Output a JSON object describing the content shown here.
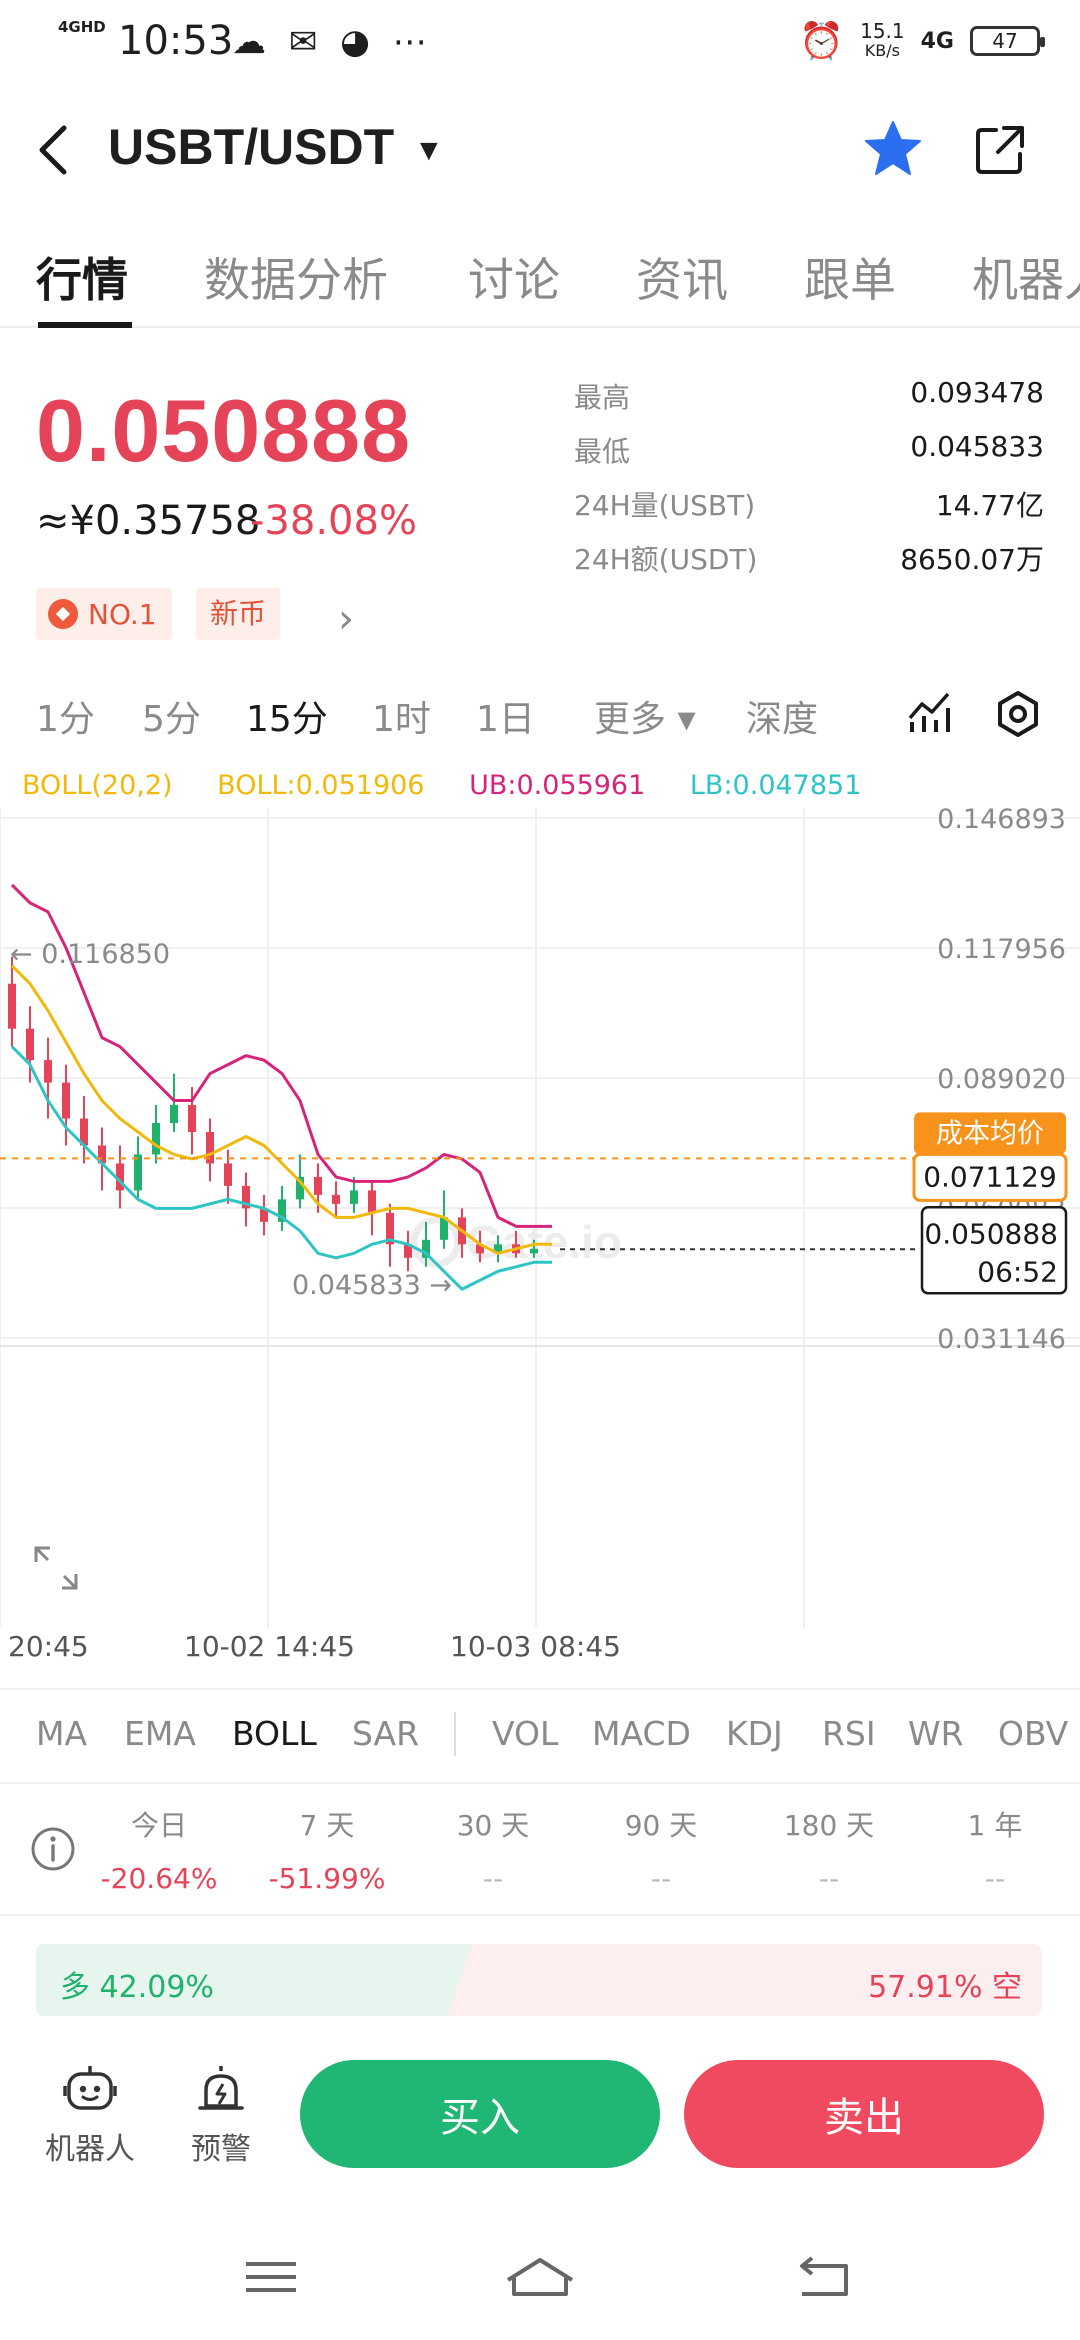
{
  "status_bar": {
    "network": "4GHD",
    "time": "10:53",
    "speed_value": "15.1",
    "speed_unit": "KB/s",
    "signal": "4G",
    "battery": "47"
  },
  "header": {
    "pair": "USBT/USDT"
  },
  "tabs": [
    "行情",
    "数据分析",
    "讨论",
    "资讯",
    "跟单",
    "机器人"
  ],
  "price": {
    "last": "0.050888",
    "cny": "≈¥0.35758",
    "change": "-38.08%",
    "badge_rank": "NO.1",
    "badge_new": "新币"
  },
  "stats": [
    {
      "label": "最高",
      "value": "0.093478"
    },
    {
      "label": "最低",
      "value": "0.045833"
    },
    {
      "label": "24H量(USBT)",
      "value": "14.77亿"
    },
    {
      "label": "24H额(USDT)",
      "value": "8650.07万"
    }
  ],
  "intervals": [
    "1分",
    "5分",
    "15分",
    "1时",
    "1日",
    "更多 ▾",
    "深度"
  ],
  "active_interval": "15分",
  "boll_legend": {
    "params": "BOLL(20,2)",
    "mid": "BOLL:0.051906",
    "ub": "UB:0.055961",
    "lb": "LB:0.047851"
  },
  "colors": {
    "up": "#20b26c",
    "down": "#e54458",
    "boll_mid": "#f0b90b",
    "boll_ub": "#d6247a",
    "boll_lb": "#2ec4c4",
    "cost_label": "#f7931a"
  },
  "chart_data": {
    "type": "candlestick",
    "price_axis_labels": [
      "0.146893",
      "0.117956",
      "0.089020",
      "0.060083",
      "0.031146"
    ],
    "ylim": [
      0.031146,
      0.146893
    ],
    "time_axis_labels": [
      "20:45",
      "10-02 14:45",
      "10-03 08:45"
    ],
    "high_marker": "0.116850",
    "low_marker": "0.045833",
    "cost_avg_label": "成本均价",
    "cost_avg_value": "0.071129",
    "last_price": "0.050888",
    "countdown": "06:52",
    "watermark": "Gate.io",
    "series": [
      {
        "name": "UB",
        "values": [
          0.132,
          0.128,
          0.126,
          0.118,
          0.108,
          0.098,
          0.096,
          0.092,
          0.088,
          0.084,
          0.084,
          0.09,
          0.092,
          0.094,
          0.093,
          0.09,
          0.084,
          0.072,
          0.067,
          0.066,
          0.066,
          0.066,
          0.067,
          0.069,
          0.072,
          0.071,
          0.068,
          0.058,
          0.056,
          0.056,
          0.056
        ]
      },
      {
        "name": "BOLL",
        "values": [
          0.114,
          0.11,
          0.104,
          0.097,
          0.09,
          0.084,
          0.08,
          0.077,
          0.074,
          0.072,
          0.071,
          0.072,
          0.074,
          0.076,
          0.074,
          0.07,
          0.066,
          0.061,
          0.058,
          0.058,
          0.059,
          0.06,
          0.06,
          0.059,
          0.058,
          0.055,
          0.052,
          0.05,
          0.051,
          0.052,
          0.052
        ]
      },
      {
        "name": "LB",
        "values": [
          0.096,
          0.092,
          0.084,
          0.078,
          0.074,
          0.07,
          0.066,
          0.062,
          0.06,
          0.06,
          0.06,
          0.061,
          0.062,
          0.061,
          0.06,
          0.058,
          0.055,
          0.05,
          0.049,
          0.05,
          0.052,
          0.053,
          0.052,
          0.05,
          0.046,
          0.042,
          0.044,
          0.046,
          0.047,
          0.048,
          0.048
        ]
      }
    ],
    "candles": [
      {
        "o": 0.11,
        "c": 0.1,
        "h": 0.116,
        "l": 0.096
      },
      {
        "o": 0.1,
        "c": 0.093,
        "h": 0.105,
        "l": 0.088
      },
      {
        "o": 0.093,
        "c": 0.088,
        "h": 0.098,
        "l": 0.08
      },
      {
        "o": 0.088,
        "c": 0.08,
        "h": 0.092,
        "l": 0.074
      },
      {
        "o": 0.08,
        "c": 0.074,
        "h": 0.085,
        "l": 0.07
      },
      {
        "o": 0.074,
        "c": 0.07,
        "h": 0.078,
        "l": 0.064
      },
      {
        "o": 0.07,
        "c": 0.064,
        "h": 0.074,
        "l": 0.06
      },
      {
        "o": 0.064,
        "c": 0.072,
        "h": 0.076,
        "l": 0.062
      },
      {
        "o": 0.072,
        "c": 0.079,
        "h": 0.083,
        "l": 0.07
      },
      {
        "o": 0.079,
        "c": 0.083,
        "h": 0.09,
        "l": 0.077
      },
      {
        "o": 0.083,
        "c": 0.077,
        "h": 0.087,
        "l": 0.072
      },
      {
        "o": 0.077,
        "c": 0.07,
        "h": 0.08,
        "l": 0.066
      },
      {
        "o": 0.07,
        "c": 0.065,
        "h": 0.073,
        "l": 0.061
      },
      {
        "o": 0.065,
        "c": 0.06,
        "h": 0.068,
        "l": 0.056
      },
      {
        "o": 0.06,
        "c": 0.057,
        "h": 0.063,
        "l": 0.054
      },
      {
        "o": 0.057,
        "c": 0.062,
        "h": 0.065,
        "l": 0.055
      },
      {
        "o": 0.062,
        "c": 0.067,
        "h": 0.072,
        "l": 0.06
      },
      {
        "o": 0.067,
        "c": 0.063,
        "h": 0.07,
        "l": 0.059
      },
      {
        "o": 0.063,
        "c": 0.061,
        "h": 0.066,
        "l": 0.058
      },
      {
        "o": 0.061,
        "c": 0.064,
        "h": 0.067,
        "l": 0.059
      },
      {
        "o": 0.064,
        "c": 0.059,
        "h": 0.066,
        "l": 0.054
      },
      {
        "o": 0.059,
        "c": 0.052,
        "h": 0.061,
        "l": 0.047
      },
      {
        "o": 0.052,
        "c": 0.049,
        "h": 0.055,
        "l": 0.046
      },
      {
        "o": 0.049,
        "c": 0.053,
        "h": 0.057,
        "l": 0.047
      },
      {
        "o": 0.053,
        "c": 0.058,
        "h": 0.064,
        "l": 0.051
      },
      {
        "o": 0.058,
        "c": 0.052,
        "h": 0.06,
        "l": 0.049
      },
      {
        "o": 0.052,
        "c": 0.05,
        "h": 0.055,
        "l": 0.048
      },
      {
        "o": 0.05,
        "c": 0.052,
        "h": 0.054,
        "l": 0.048
      },
      {
        "o": 0.052,
        "c": 0.05,
        "h": 0.055,
        "l": 0.049
      },
      {
        "o": 0.05,
        "c": 0.051,
        "h": 0.053,
        "l": 0.049
      }
    ]
  },
  "indicators": [
    "MA",
    "EMA",
    "BOLL",
    "SAR",
    "VOL",
    "MACD",
    "KDJ",
    "RSI",
    "WR",
    "OBV"
  ],
  "active_indicator": "BOLL",
  "performance": [
    {
      "label": "今日",
      "value": "-20.64%"
    },
    {
      "label": "7 天",
      "value": "-51.99%"
    },
    {
      "label": "30 天",
      "value": "--"
    },
    {
      "label": "90 天",
      "value": "--"
    },
    {
      "label": "180 天",
      "value": "--"
    },
    {
      "label": "1 年",
      "value": "--"
    }
  ],
  "long_short": {
    "long_label": "多 42.09%",
    "short_label": "57.91% 空",
    "long_ratio": 0.4209
  },
  "bottom_bar": {
    "robot_label": "机器人",
    "alert_label": "预警",
    "buy_label": "买入",
    "sell_label": "卖出"
  }
}
